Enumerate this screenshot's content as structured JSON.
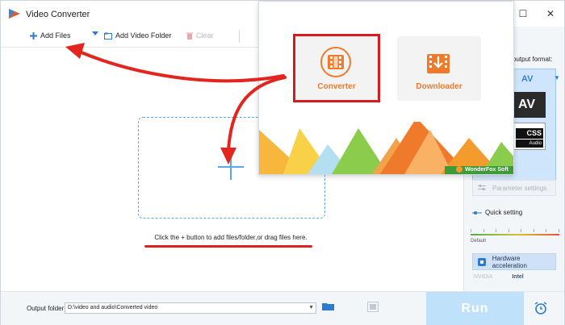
{
  "window": {
    "title": "Video Converter",
    "controls": [
      "minimize-icon",
      "maximize-icon",
      "close-icon"
    ]
  },
  "toolbar": {
    "add_files": "Add Files",
    "add_video_folder": "Add Video Folder",
    "clear": "Clear"
  },
  "workspace": {
    "hint": "Click the + button to add files/folder,or drag files here."
  },
  "popup": {
    "converter_label": "Converter",
    "downloader_label": "Downloader",
    "brand": "WonderFox Soft"
  },
  "right_panel": {
    "output_format_label": "output format:",
    "format_visible_text": "AV",
    "format_tile_1": "AV",
    "format_tile_2_line1": "CSS",
    "format_tile_2_line2": "Audio",
    "parameter_settings": "Parameter settings",
    "quick_setting": "Quick setting",
    "quality_default": "Default",
    "hardware_acceleration": "Hardware acceleration",
    "vendor_nvidia": "NVIDIA",
    "vendor_intel": "Intel"
  },
  "bottom": {
    "output_folder_label": "Output folder:",
    "output_folder_value": "D:\\video and audio\\Converted video",
    "run": "Run"
  },
  "colors": {
    "accent_blue": "#3b7fd0",
    "highlight_red": "#d8191d",
    "converter_orange": "#ef7a2b",
    "run_disabled": "#bfe2fa"
  }
}
